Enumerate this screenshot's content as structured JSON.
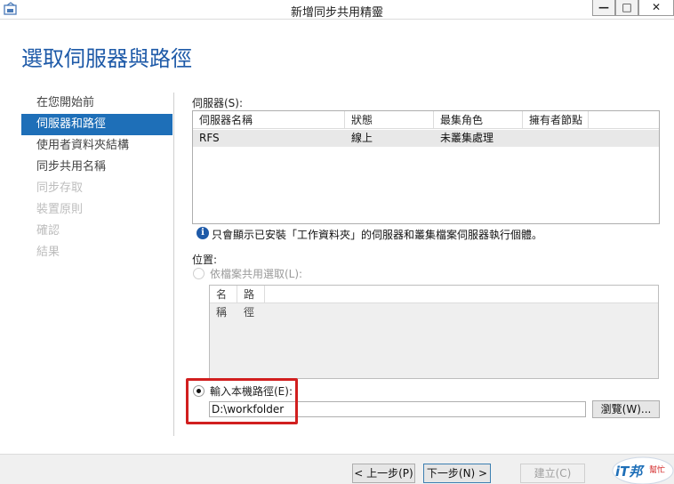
{
  "window": {
    "title": "新增同步共用精靈",
    "minimize_glyph": "—",
    "maximize_glyph": "□",
    "close_glyph": "✕"
  },
  "page": {
    "heading": "選取伺服器與路徑"
  },
  "nav": {
    "items": [
      {
        "label": "在您開始前",
        "state": "normal"
      },
      {
        "label": "伺服器和路徑",
        "state": "active"
      },
      {
        "label": "使用者資料夾結構",
        "state": "normal"
      },
      {
        "label": "同步共用名稱",
        "state": "normal"
      },
      {
        "label": "同步存取",
        "state": "disabled"
      },
      {
        "label": "裝置原則",
        "state": "disabled"
      },
      {
        "label": "確認",
        "state": "disabled"
      },
      {
        "label": "結果",
        "state": "disabled"
      }
    ]
  },
  "servers": {
    "label": "伺服器(S):",
    "columns": [
      "伺服器名稱",
      "狀態",
      "最集角色",
      "擁有者節點"
    ],
    "rows": [
      {
        "name": "RFS",
        "status": "線上",
        "role": "未叢集處理",
        "owner": ""
      }
    ]
  },
  "info": {
    "text": "只會顯示已安裝「工作資料夾」的伺服器和叢集檔案伺服器執行個體。"
  },
  "location": {
    "label": "位置:",
    "by_share_label": "依檔案共用選取(L):",
    "share_columns": [
      "名稱",
      "路徑"
    ],
    "local_path_label": "輸入本機路徑(E):",
    "local_path_value": "D:\\workfolder",
    "browse_label": "瀏覽(W)..."
  },
  "footer": {
    "prev_label": "< 上一步(P)",
    "next_label": "下一步(N) >",
    "create_label": "建立(C)"
  },
  "watermark": {
    "text": "iT邦幫忙"
  },
  "colors": {
    "heading": "#1e5aa8",
    "nav_active": "#1e6fb8",
    "highlight": "#d11f1f"
  }
}
